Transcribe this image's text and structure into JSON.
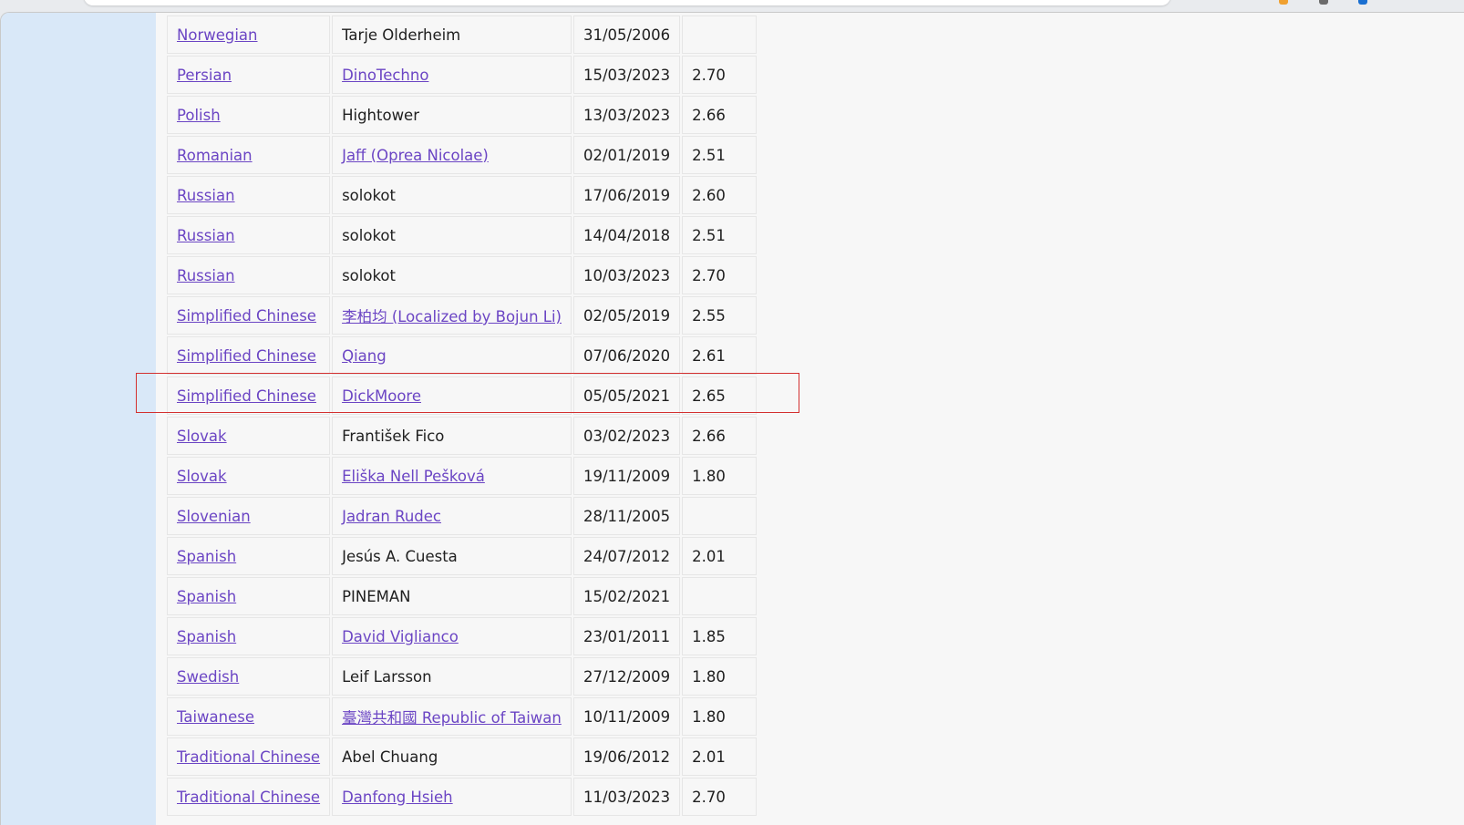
{
  "extension_colors": [
    "#f0a030",
    "#6b6b6b",
    "#1a6fd1"
  ],
  "link_color": "#6b45c4",
  "highlight_color": "#d32f2f",
  "rows": [
    {
      "language": "Norwegian",
      "translator": "Tarje Olderheim",
      "translator_link": false,
      "date": "31/05/2006",
      "version": ""
    },
    {
      "language": "Persian",
      "translator": "DinoTechno",
      "translator_link": true,
      "date": "15/03/2023",
      "version": "2.70"
    },
    {
      "language": "Polish",
      "translator": "Hightower",
      "translator_link": false,
      "date": "13/03/2023",
      "version": "2.66"
    },
    {
      "language": "Romanian",
      "translator": "Jaff (Oprea Nicolae)",
      "translator_link": true,
      "date": "02/01/2019",
      "version": "2.51"
    },
    {
      "language": "Russian",
      "translator": "solokot",
      "translator_link": false,
      "date": "17/06/2019",
      "version": "2.60"
    },
    {
      "language": "Russian",
      "translator": "solokot",
      "translator_link": false,
      "date": "14/04/2018",
      "version": "2.51"
    },
    {
      "language": "Russian",
      "translator": "solokot",
      "translator_link": false,
      "date": "10/03/2023",
      "version": "2.70"
    },
    {
      "language": "Simplified Chinese",
      "translator": "李柏均 (Localized by Bojun Li)",
      "translator_link": true,
      "date": "02/05/2019",
      "version": "2.55"
    },
    {
      "language": "Simplified Chinese",
      "translator": "Qiang",
      "translator_link": true,
      "date": "07/06/2020",
      "version": "2.61"
    },
    {
      "language": "Simplified Chinese",
      "translator": "DickMoore",
      "translator_link": true,
      "date": "05/05/2021",
      "version": "2.65",
      "highlighted": true
    },
    {
      "language": "Slovak",
      "translator": "František Fico",
      "translator_link": false,
      "date": "03/02/2023",
      "version": "2.66"
    },
    {
      "language": "Slovak",
      "translator": "Eliška Nell Pešková",
      "translator_link": true,
      "date": "19/11/2009",
      "version": "1.80"
    },
    {
      "language": "Slovenian",
      "translator": "Jadran Rudec",
      "translator_link": true,
      "date": "28/11/2005",
      "version": ""
    },
    {
      "language": "Spanish",
      "translator": "Jesús A. Cuesta",
      "translator_link": false,
      "date": "24/07/2012",
      "version": "2.01"
    },
    {
      "language": "Spanish",
      "translator": "PINEMAN",
      "translator_link": false,
      "date": "15/02/2021",
      "version": ""
    },
    {
      "language": "Spanish",
      "translator": "David Viglianco",
      "translator_link": true,
      "date": "23/01/2011",
      "version": "1.85"
    },
    {
      "language": "Swedish",
      "translator": "Leif Larsson",
      "translator_link": false,
      "date": "27/12/2009",
      "version": "1.80"
    },
    {
      "language": "Taiwanese",
      "translator": "臺灣共和國 Republic of Taiwan",
      "translator_link": true,
      "date": "10/11/2009",
      "version": "1.80"
    },
    {
      "language": "Traditional Chinese",
      "translator": "Abel Chuang",
      "translator_link": false,
      "date": "19/06/2012",
      "version": "2.01"
    },
    {
      "language": "Traditional Chinese",
      "translator": "Danfong Hsieh",
      "translator_link": true,
      "date": "11/03/2023",
      "version": "2.70"
    }
  ]
}
